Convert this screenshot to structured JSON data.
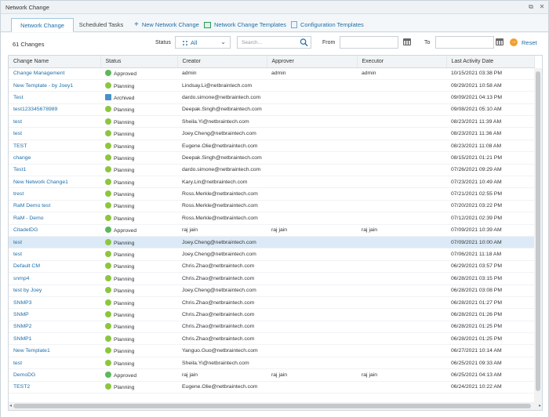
{
  "window": {
    "title": "Network Change"
  },
  "tabs": [
    {
      "label": "Network Change",
      "active": true
    },
    {
      "label": "Scheduled Tasks",
      "active": false
    }
  ],
  "toolbar": {
    "new_change": "New Network Change",
    "templates": "Network Change Templates",
    "config_templates": "Configuration Templates"
  },
  "filters": {
    "count": "61 Changes",
    "status_label": "Status",
    "status_value": "All",
    "search_placeholder": "Search...",
    "from_label": "From",
    "to_label": "To",
    "reset": "Reset"
  },
  "table": {
    "columns": [
      "Change Name",
      "Status",
      "Creator",
      "Approver",
      "Executor",
      "Last Activity Date"
    ],
    "rows": [
      {
        "name": "Change Management",
        "status": "Approved",
        "creator": "admin",
        "approver": "admin",
        "executor": "admin",
        "date": "10/15/2021 03:38 PM"
      },
      {
        "name": "New Template - by Joey1",
        "status": "Planning",
        "creator": "Lindsay.Li@netbraintech.com",
        "approver": "",
        "executor": "",
        "date": "09/29/2021 10:58 AM"
      },
      {
        "name": "Test",
        "status": "Archived",
        "creator": "dardo.simone@netbraintech.com",
        "approver": "",
        "executor": "",
        "date": "09/09/2021 04:13 PM"
      },
      {
        "name": "test123345678989",
        "status": "Planning",
        "creator": "Deepak.Singh@netbraintech.com",
        "approver": "",
        "executor": "",
        "date": "09/08/2021 05:10 AM"
      },
      {
        "name": "test",
        "status": "Planning",
        "creator": "Sheila.Yi@netbraintech.com",
        "approver": "",
        "executor": "",
        "date": "08/23/2021 11:39 AM"
      },
      {
        "name": "test",
        "status": "Planning",
        "creator": "Joey.Cheng@netbraintech.com",
        "approver": "",
        "executor": "",
        "date": "08/23/2021 11:36 AM"
      },
      {
        "name": "TEST",
        "status": "Planning",
        "creator": "Eugene.Olie@netbraintech.com",
        "approver": "",
        "executor": "",
        "date": "08/23/2021 11:08 AM"
      },
      {
        "name": "change",
        "status": "Planning",
        "creator": "Deepak.Singh@netbraintech.com",
        "approver": "",
        "executor": "",
        "date": "08/15/2021 01:21 PM"
      },
      {
        "name": "Test1",
        "status": "Planning",
        "creator": "dardo.simone@netbraintech.com",
        "approver": "",
        "executor": "",
        "date": "07/26/2021 09:29 AM"
      },
      {
        "name": "New Network Change1",
        "status": "Planning",
        "creator": "Kary.Lin@netbraintech.com",
        "approver": "",
        "executor": "",
        "date": "07/23/2021 10:49 AM"
      },
      {
        "name": "trest",
        "status": "Planning",
        "creator": "Ross.Merkle@netbraintech.com",
        "approver": "",
        "executor": "",
        "date": "07/21/2021 02:55 PM"
      },
      {
        "name": "RaM Demo test",
        "status": "Planning",
        "creator": "Ross.Merkle@netbraintech.com",
        "approver": "",
        "executor": "",
        "date": "07/20/2021 03:22 PM"
      },
      {
        "name": "RaM - Demo",
        "status": "Planning",
        "creator": "Ross.Merkle@netbraintech.com",
        "approver": "",
        "executor": "",
        "date": "07/12/2021 02:39 PM"
      },
      {
        "name": "CitadelDG",
        "status": "Approved",
        "creator": "raj jain",
        "approver": "raj jain",
        "executor": "raj jain",
        "date": "07/09/2021 10:39 AM"
      },
      {
        "name": "test",
        "status": "Planning",
        "creator": "Joey.Cheng@netbraintech.com",
        "approver": "",
        "executor": "",
        "date": "07/09/2021 10:00 AM",
        "selected": true
      },
      {
        "name": "test",
        "status": "Planning",
        "creator": "Joey.Cheng@netbraintech.com",
        "approver": "",
        "executor": "",
        "date": "07/06/2021 11:18 AM"
      },
      {
        "name": "Default CM",
        "status": "Planning",
        "creator": "Chris.Zhao@netbraintech.com",
        "approver": "",
        "executor": "",
        "date": "06/29/2021 03:57 PM"
      },
      {
        "name": "snmp4",
        "status": "Planning",
        "creator": "Chris.Zhao@netbraintech.com",
        "approver": "",
        "executor": "",
        "date": "06/28/2021 03:15 PM"
      },
      {
        "name": "test by Joey",
        "status": "Planning",
        "creator": "Joey.Cheng@netbraintech.com",
        "approver": "",
        "executor": "",
        "date": "06/28/2021 03:08 PM"
      },
      {
        "name": "SNMP3",
        "status": "Planning",
        "creator": "Chris.Zhao@netbraintech.com",
        "approver": "",
        "executor": "",
        "date": "06/28/2021 01:27 PM"
      },
      {
        "name": "SNMP",
        "status": "Planning",
        "creator": "Chris.Zhao@netbraintech.com",
        "approver": "",
        "executor": "",
        "date": "06/28/2021 01:26 PM"
      },
      {
        "name": "SNMP2",
        "status": "Planning",
        "creator": "Chris.Zhao@netbraintech.com",
        "approver": "",
        "executor": "",
        "date": "06/28/2021 01:25 PM"
      },
      {
        "name": "SNMP1",
        "status": "Planning",
        "creator": "Chris.Zhao@netbraintech.com",
        "approver": "",
        "executor": "",
        "date": "06/28/2021 01:25 PM"
      },
      {
        "name": "New Template1",
        "status": "Planning",
        "creator": "Yanguo.Guo@netbraintech.com",
        "approver": "",
        "executor": "",
        "date": "06/27/2021 10:14 AM"
      },
      {
        "name": "test",
        "status": "Planning",
        "creator": "Sheila.Yi@netbraintech.com",
        "approver": "",
        "executor": "",
        "date": "06/25/2021 09:33 AM"
      },
      {
        "name": "DemoDG",
        "status": "Approved",
        "creator": "raj jain",
        "approver": "raj jain",
        "executor": "raj jain",
        "date": "06/25/2021 04:13 AM"
      },
      {
        "name": "TEST2",
        "status": "Planning",
        "creator": "Eugene.Olie@netbraintech.com",
        "approver": "",
        "executor": "",
        "date": "06/24/2021 10:22 AM"
      }
    ]
  }
}
